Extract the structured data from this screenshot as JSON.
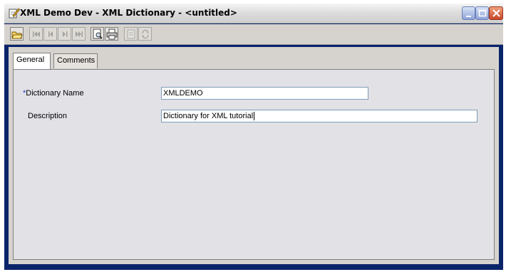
{
  "window": {
    "title": "XML Demo Dev - XML Dictionary - <untitled>",
    "icon": "edit-pencil-icon",
    "controls": [
      "minimize-icon",
      "maximize-icon",
      "close-icon"
    ],
    "titlebar_color": "#d8d8d8",
    "frame_color": "#0a246a"
  },
  "toolbar": {
    "buttons": [
      {
        "icon": "open-folder-icon",
        "enabled": true
      },
      {
        "icon": "first-record-icon",
        "enabled": false
      },
      {
        "icon": "previous-record-icon",
        "enabled": false
      },
      {
        "icon": "next-record-icon",
        "enabled": false
      },
      {
        "icon": "last-record-icon",
        "enabled": false
      },
      {
        "icon": "print-preview-icon",
        "enabled": true
      },
      {
        "icon": "print-icon",
        "enabled": true
      },
      {
        "icon": "document-icon",
        "enabled": false
      },
      {
        "icon": "refresh-icon",
        "enabled": false
      }
    ]
  },
  "tabs": [
    {
      "label": "General",
      "active": true
    },
    {
      "label": "Comments",
      "active": false
    }
  ],
  "form": {
    "dictionary_name": {
      "label": "Dictionary Name",
      "required_marker": "*",
      "value": "XMLDEMO"
    },
    "description": {
      "label": "Description",
      "value": "Dictionary for XML tutorial"
    }
  }
}
